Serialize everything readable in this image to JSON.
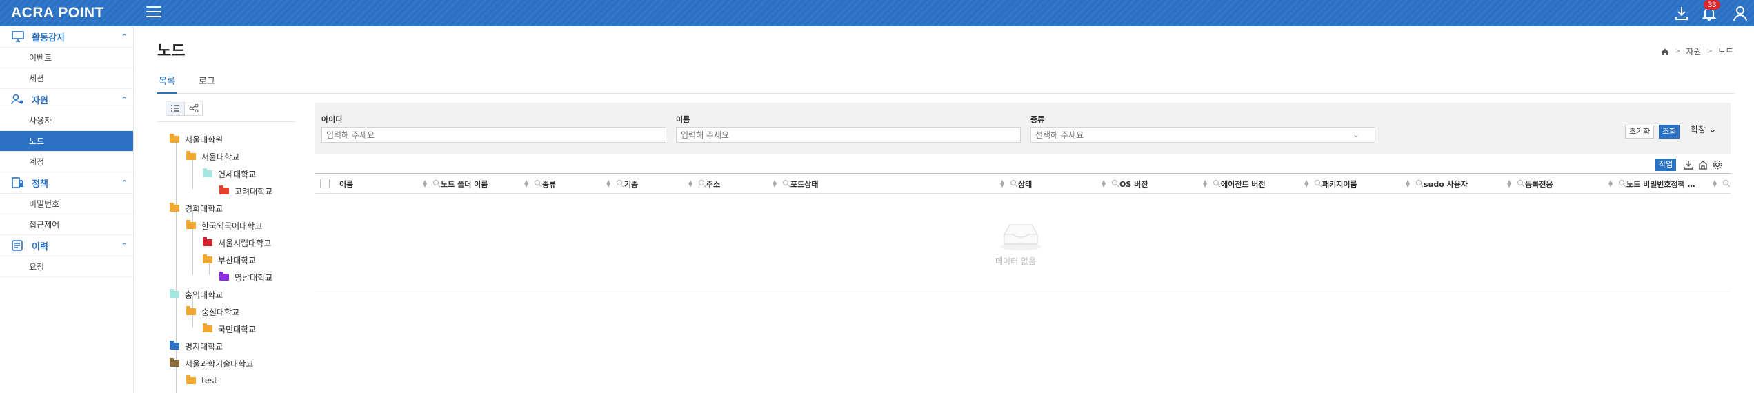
{
  "app": {
    "logo_text": "ACRA POINT",
    "notification_count": "33"
  },
  "sidebar": {
    "sections": [
      {
        "label": "활동감지",
        "items": [
          "이벤트",
          "세션"
        ]
      },
      {
        "label": "자원",
        "items": [
          "사용자",
          "노드",
          "계정"
        ]
      },
      {
        "label": "정책",
        "items": [
          "비밀번호",
          "접근제어"
        ]
      },
      {
        "label": "이력",
        "items": [
          "요청"
        ]
      }
    ],
    "active_item": "노드"
  },
  "page": {
    "title": "노드"
  },
  "breadcrumb": {
    "level1": "자원",
    "level2": "노드"
  },
  "tabs": [
    "목록",
    "로그"
  ],
  "tree": {
    "nodes": [
      {
        "label": "서울대학원",
        "color": "#f0a830"
      },
      {
        "label": "서울대학교",
        "color": "#f0a830"
      },
      {
        "label": "연세대학교",
        "color": "#a8e6e0"
      },
      {
        "label": "고려대학교",
        "color": "#e8412c"
      },
      {
        "label": "경희대학교",
        "color": "#f0a830"
      },
      {
        "label": "한국외국어대학교",
        "color": "#f0a830"
      },
      {
        "label": "서울시립대학교",
        "color": "#d2202e"
      },
      {
        "label": "부산대학교",
        "color": "#f0a830"
      },
      {
        "label": "영남대학교",
        "color": "#8b2be2"
      },
      {
        "label": "홍익대학교",
        "color": "#a8e6e0"
      },
      {
        "label": "숭실대학교",
        "color": "#f0a830"
      },
      {
        "label": "국민대학교",
        "color": "#f0a830"
      },
      {
        "label": "명지대학교",
        "color": "#2b72c5"
      },
      {
        "label": "서울과학기술대학교",
        "color": "#8a6a3a"
      },
      {
        "label": "test",
        "color": "#f0a830"
      }
    ]
  },
  "filter": {
    "id_label": "아이디",
    "id_placeholder": "입력해 주세요",
    "name_label": "이름",
    "name_placeholder": "입력해 주세요",
    "type_label": "종류",
    "type_placeholder": "선택해 주세요",
    "reset_label": "초기화",
    "search_label": "조회",
    "expand_label": "확장"
  },
  "actions": {
    "task_label": "작업"
  },
  "table": {
    "columns": [
      "이름",
      "노드 폴더 이름",
      "종류",
      "기종",
      "주소",
      "포트상태",
      "상태",
      "OS 버전",
      "에이전트 버전",
      "패키지이름",
      "sudo 사용자",
      "등록전용",
      "노드 비밀번호정책 …"
    ],
    "empty_text": "데이터 없음"
  }
}
